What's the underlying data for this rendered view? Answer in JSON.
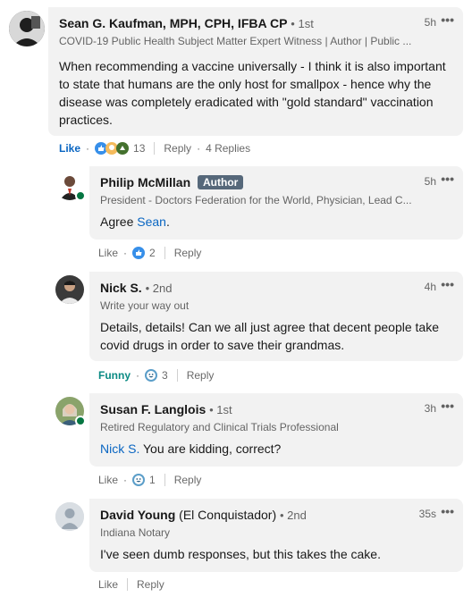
{
  "comments": [
    {
      "name": "Sean G. Kaufman, MPH, CPH, IFBA CP",
      "name_extra": "",
      "degree": "• 1st",
      "headline": "COVID-19 Public Health Subject Matter Expert Witness | Author | Public ...",
      "time": "5h",
      "text": "When recommending a vaccine universally - I think it is also important to state that humans are the only host for smallpox - hence why the disease was completely eradicated with \"gold standard\" vaccination practices.",
      "reaction_label": "Like",
      "reaction_count": "13",
      "reply_label": "Reply",
      "replies_label": "4 Replies"
    },
    {
      "name": "Philip McMillan",
      "badge": "Author",
      "headline": "President - Doctors Federation for the World, Physician, Lead C...",
      "time": "5h",
      "text_prefix": "Agree ",
      "mention": "Sean",
      "text_suffix": ".",
      "reaction_label": "Like",
      "reaction_count": "2",
      "reply_label": "Reply"
    },
    {
      "name": "Nick S.",
      "degree": "• 2nd",
      "headline": "Write your way out",
      "time": "4h",
      "text": "Details, details! Can we all just agree that decent people take covid drugs in order to save their grandmas.",
      "reaction_label": "Funny",
      "reaction_count": "3",
      "reply_label": "Reply"
    },
    {
      "name": "Susan F. Langlois",
      "degree": "• 1st",
      "headline": "Retired Regulatory and Clinical Trials Professional",
      "time": "3h",
      "mention": "Nick S.",
      "text_suffix": " You are kidding, correct?",
      "reaction_label": "Like",
      "reaction_count": "1",
      "reply_label": "Reply"
    },
    {
      "name": "David Young",
      "name_extra": "(El Conquistador)",
      "degree": "• 2nd",
      "headline": "Indiana Notary",
      "time": "35s",
      "text": "I've seen dumb responses, but this takes the cake.",
      "reaction_label": "Like",
      "reply_label": "Reply"
    }
  ],
  "more_glyph": "•••",
  "dot_glyph": "·",
  "colors": {
    "bubble": "#f2f2f2",
    "link_blue": "#0a66c2",
    "funny_teal": "#0a8a83",
    "online_green": "#057642",
    "author_badge": "#56687a"
  }
}
